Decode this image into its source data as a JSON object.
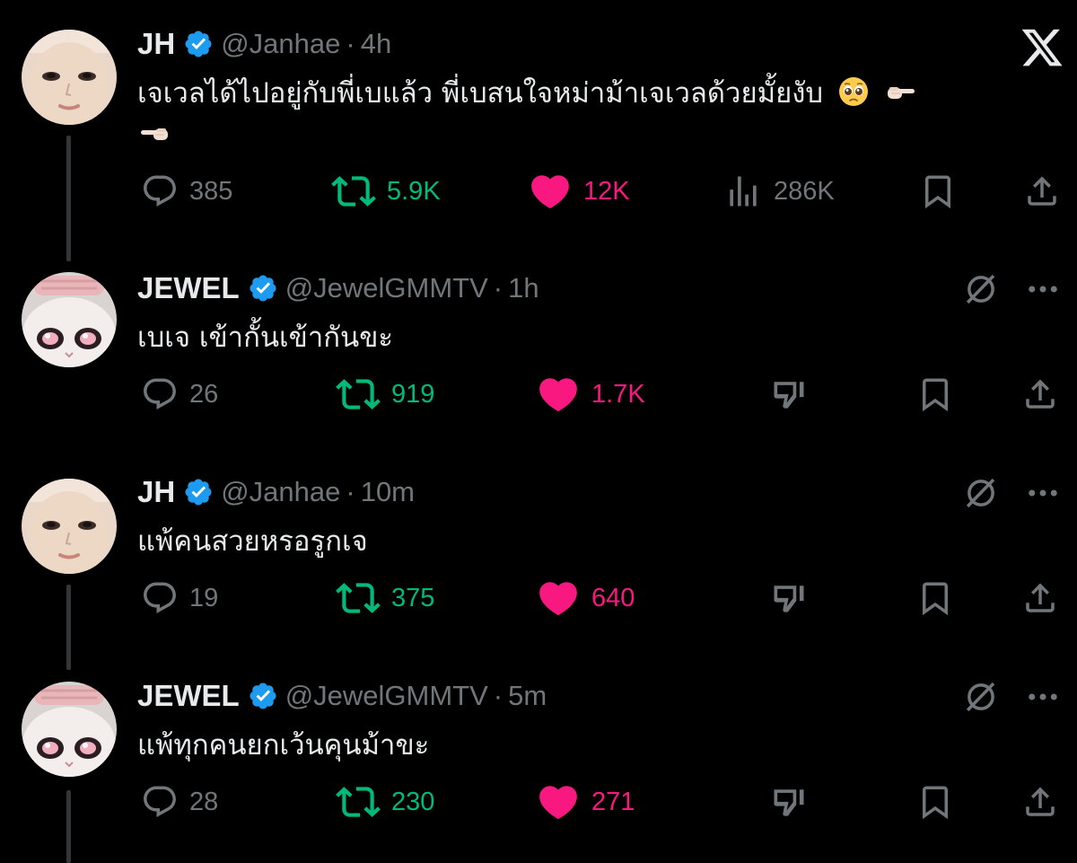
{
  "tweets": [
    {
      "name": "JH",
      "handle": "@Janhae",
      "dot": "·",
      "time": "4h",
      "text_line1": "เจเวลได้ไปอยู่กับพี่เบแล้ว พี่เบสนใจหม่าม้าเจเวลด้วยมั้ยงับ",
      "emojis": [
        "pleading-face",
        "backhand-index-pointing-right",
        "backhand-index-pointing-left"
      ],
      "replies": "385",
      "reposts": "5.9K",
      "likes": "12K",
      "views": "286K"
    },
    {
      "name": "JEWEL",
      "handle": "@JewelGMMTV",
      "dot": "·",
      "time": "1h",
      "text": "เบเจ เข้ากั้นเข้ากันขะ",
      "replies": "26",
      "reposts": "919",
      "likes": "1.7K"
    },
    {
      "name": "JH",
      "handle": "@Janhae",
      "dot": "·",
      "time": "10m",
      "text": "แพ้คนสวยหรอรูกเจ",
      "replies": "19",
      "reposts": "375",
      "likes": "640"
    },
    {
      "name": "JEWEL",
      "handle": "@JewelGMMTV",
      "dot": "·",
      "time": "5m",
      "text": "แพ้ทุกคนยกเว้นคุนม้าขะ",
      "replies": "28",
      "reposts": "230",
      "likes": "271"
    }
  ],
  "colors": {
    "background": "#000000",
    "text": "#e7e9ea",
    "muted": "#71767b",
    "repost": "#00ba7c",
    "like": "#f91880",
    "verified": "#1d9bf0"
  },
  "icons": {
    "brand": "x-logo-icon",
    "reply": "reply-icon",
    "repost": "repost-icon",
    "like": "heart-icon",
    "views": "views-icon",
    "bookmark": "bookmark-icon",
    "share": "share-icon",
    "grok": "grok-icon",
    "more": "more-icon",
    "dislike": "downvote-icon"
  }
}
